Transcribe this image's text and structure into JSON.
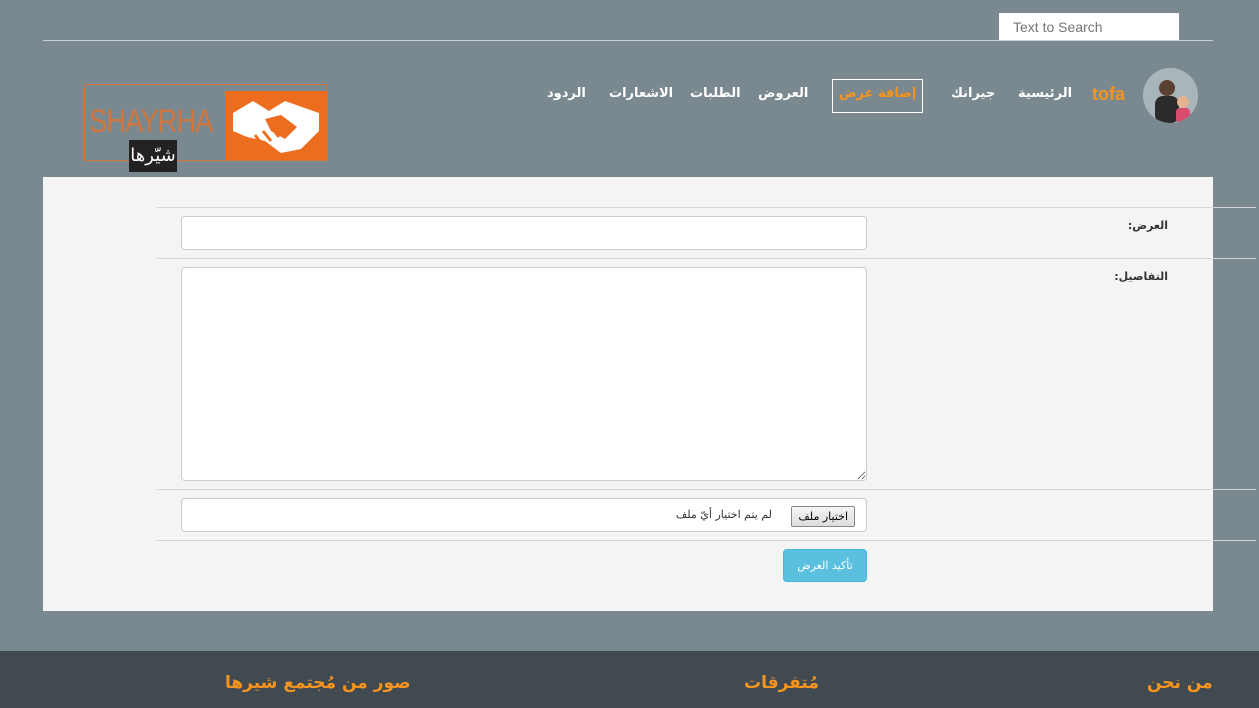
{
  "search": {
    "placeholder": "Text to Search"
  },
  "logo": {
    "text": "SHAYRHA",
    "arabic": "شيّرها"
  },
  "nav": {
    "home": "الرئيسية",
    "neighbors": "جيرانك",
    "add_offer": "إضافة عرض",
    "offers": "العروض",
    "requests": "الطلبات",
    "notifications": "الاشعارات",
    "replies": "الردود"
  },
  "user": {
    "name": "tofa"
  },
  "form": {
    "offer_label": "العرض:",
    "details_label": "التفاصيل:",
    "file_button": "اختيار ملف",
    "file_status": "لم يتم اختيار أيّ ملف",
    "submit_label": "تأكيد العرض",
    "offer_value": "",
    "details_value": ""
  },
  "footer": {
    "about": "من نحن",
    "misc": "مُتفرقات",
    "photos": "صور من مُجتمع شيرها"
  },
  "colors": {
    "background": "#7a8890",
    "accent": "#f7941d",
    "button": "#5bc0de",
    "footer": "#424a51"
  }
}
